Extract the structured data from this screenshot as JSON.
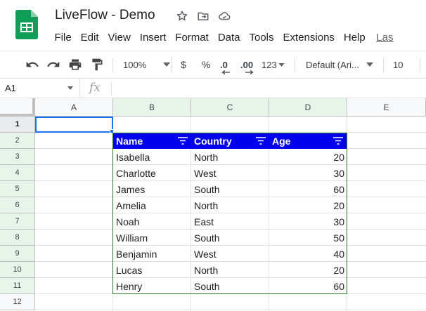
{
  "doc": {
    "title": "LiveFlow - Demo"
  },
  "menu": [
    "File",
    "Edit",
    "View",
    "Insert",
    "Format",
    "Data",
    "Tools",
    "Extensions",
    "Help"
  ],
  "menu_last": "Las",
  "toolbar": {
    "zoom": "100%",
    "currency": "$",
    "percent": "%",
    "dec_decrease": ".0",
    "dec_increase": ".00",
    "more_formats": "123",
    "font": "Default (Ari...",
    "font_size": "10"
  },
  "formula_bar": {
    "cell_ref": "A1",
    "fx": "fx"
  },
  "columns": [
    "A",
    "B",
    "C",
    "D",
    "E"
  ],
  "rows": [
    "1",
    "2",
    "3",
    "4",
    "5",
    "6",
    "7",
    "8",
    "9",
    "10",
    "11",
    "12"
  ],
  "table": {
    "headers": [
      "Name",
      "Country",
      "Age"
    ],
    "rows": [
      [
        "Isabella",
        "North",
        "20"
      ],
      [
        "Charlotte",
        "West",
        "30"
      ],
      [
        "James",
        "South",
        "60"
      ],
      [
        "Amelia",
        "North",
        "20"
      ],
      [
        "Noah",
        "East",
        "30"
      ],
      [
        "William",
        "South",
        "50"
      ],
      [
        "Benjamin",
        "West",
        "40"
      ],
      [
        "Lucas",
        "North",
        "20"
      ],
      [
        "Henry",
        "South",
        "60"
      ]
    ]
  },
  "colors": {
    "header_bg": "#0000ee",
    "accent": "#1a73e8",
    "sheets_green": "#0f9d58"
  }
}
